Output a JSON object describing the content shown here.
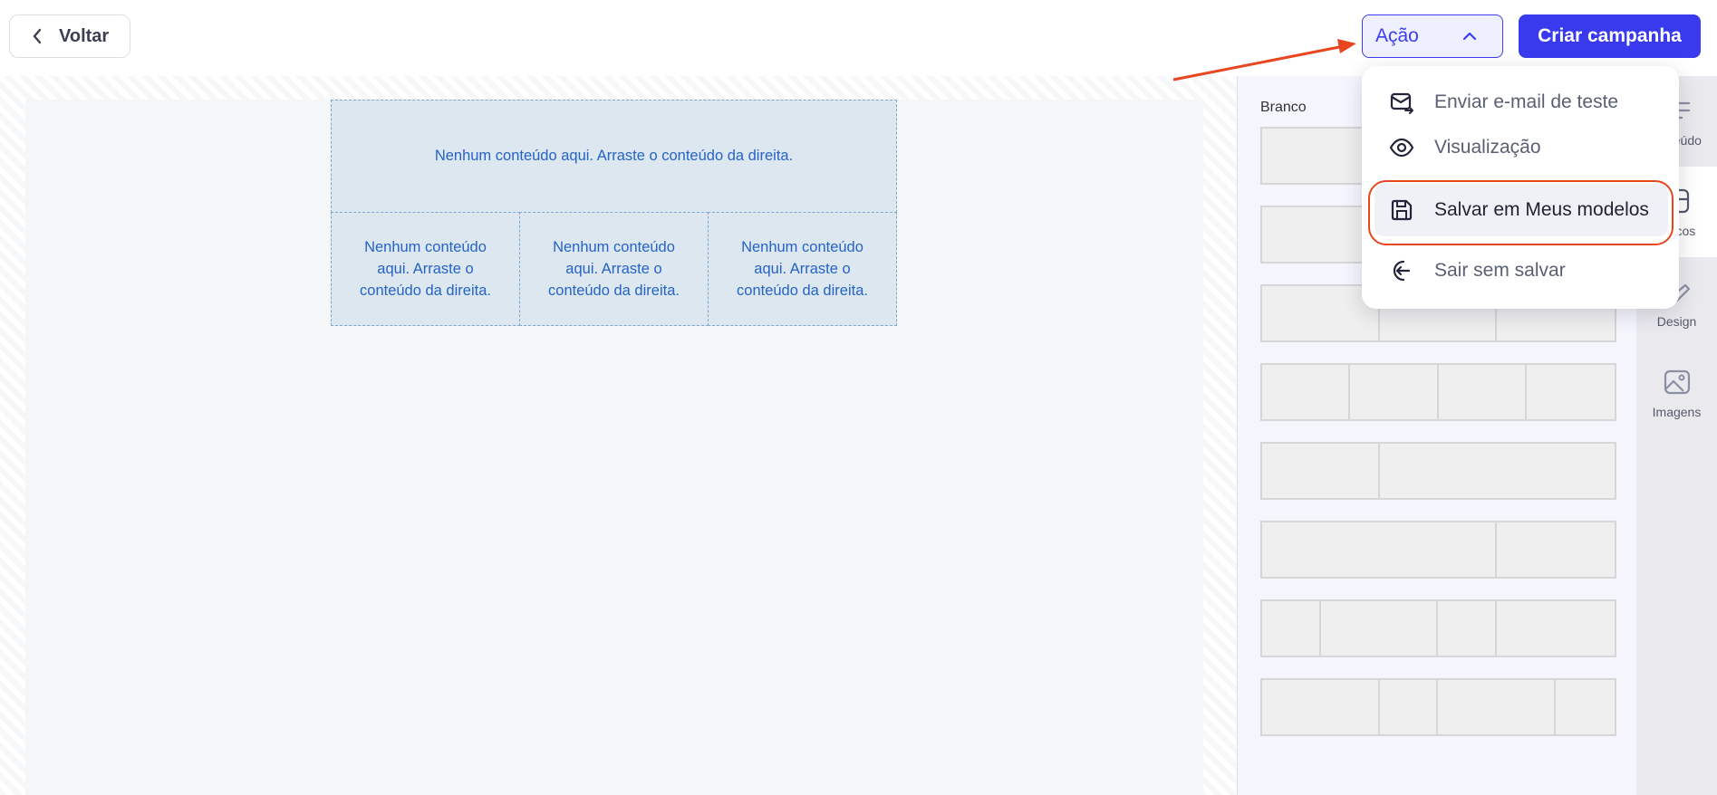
{
  "header": {
    "back_label": "Voltar",
    "action_label": "Ação",
    "create_label": "Criar campanha"
  },
  "canvas": {
    "placeholder_full": "Nenhum conteúdo aqui. Arraste o conteúdo da direita.",
    "columns": [
      "Nenhum conteúdo aqui. Arraste o conteúdo da direita.",
      "Nenhum conteúdo aqui. Arraste o conteúdo da direita.",
      "Nenhum conteúdo aqui. Arraste o conteúdo da direita."
    ]
  },
  "panel": {
    "title": "Branco"
  },
  "rail": {
    "items": [
      {
        "label": "nteúdo",
        "icon": "lines-icon"
      },
      {
        "label": "ocos",
        "icon": "blocks-icon"
      },
      {
        "label": "Design",
        "icon": "design-icon"
      },
      {
        "label": "Imagens",
        "icon": "image-icon"
      }
    ]
  },
  "dropdown": {
    "items": [
      {
        "label": "Enviar e-mail de teste",
        "icon": "mail-send-icon"
      },
      {
        "label": "Visualização",
        "icon": "eye-icon"
      },
      {
        "label": "Salvar em Meus modelos",
        "icon": "save-icon"
      },
      {
        "label": "Sair sem salvar",
        "icon": "exit-icon"
      }
    ]
  },
  "colors": {
    "primary": "#3939ee",
    "annotation": "#e8461f",
    "placeholder_text": "#2563c8"
  }
}
